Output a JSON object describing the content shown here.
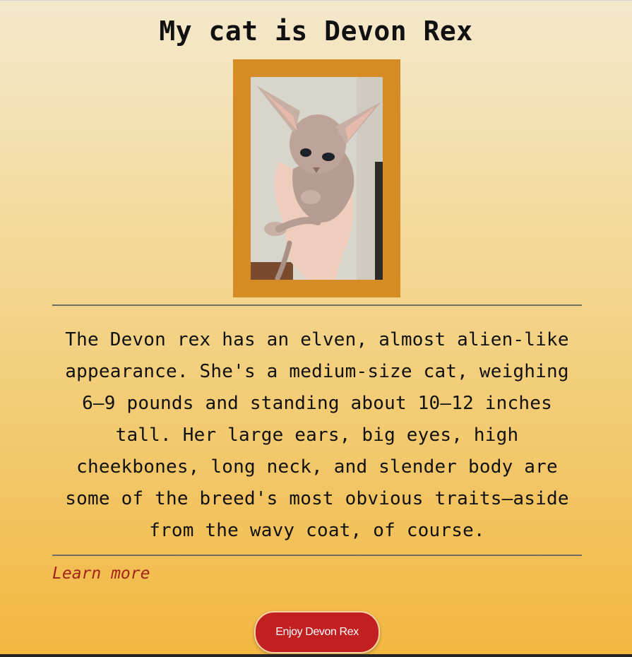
{
  "page": {
    "title": "My cat is Devon Rex"
  },
  "photo": {
    "alt": "Devon Rex kitten held in a hand",
    "frame_color": "#d68c24"
  },
  "description": "The Devon rex has an elven, almost alien-like appearance. She's a medium-size cat, weighing 6–9 pounds and standing about 10–12 inches tall. Her large ears, big eyes, high cheekbones, long neck, and slender body are some of the breed's most obvious traits—aside from the wavy coat, of course.",
  "links": {
    "learn_more": "Learn more"
  },
  "cta": {
    "label": "Enjoy Devon Rex",
    "color": "#c21f21"
  },
  "colors": {
    "background_top": "#f4e8cc",
    "background_bottom": "#f2b740",
    "link": "#a3231b"
  }
}
